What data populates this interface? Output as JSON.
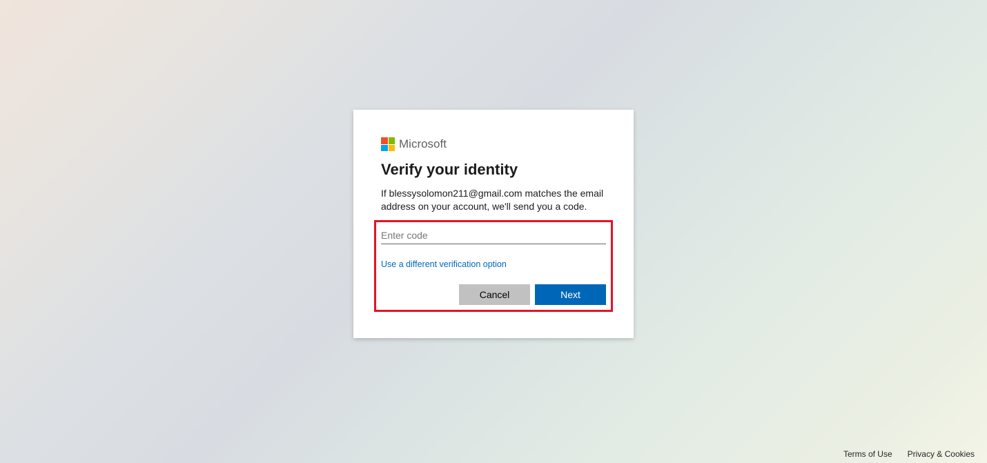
{
  "brand": {
    "name": "Microsoft"
  },
  "dialog": {
    "title": "Verify your identity",
    "description": "If blessysolomon211@gmail.com matches the email address on your account, we'll send you a code.",
    "code_placeholder": "Enter code",
    "alt_link": "Use a different verification option",
    "cancel_label": "Cancel",
    "next_label": "Next"
  },
  "footer": {
    "terms": "Terms of Use",
    "privacy": "Privacy & Cookies"
  }
}
